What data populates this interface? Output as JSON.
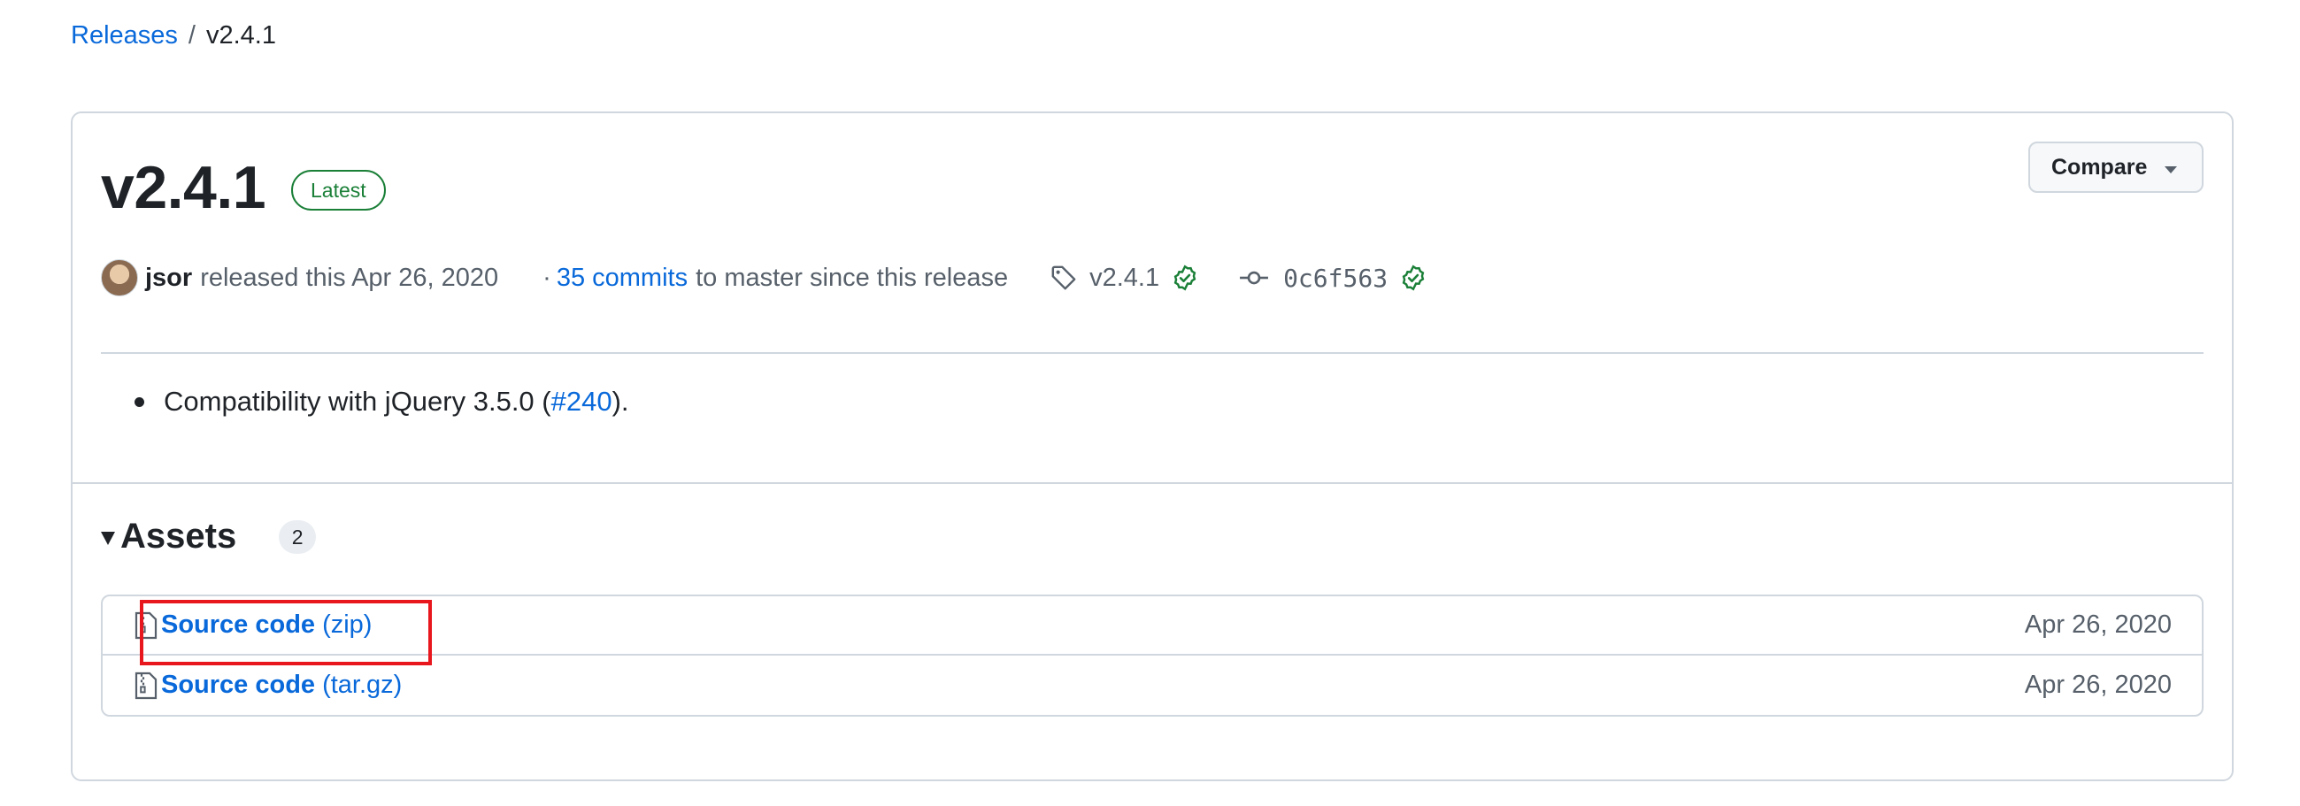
{
  "breadcrumb": {
    "parent": "Releases",
    "separator": "/",
    "current": "v2.4.1"
  },
  "release": {
    "title": "v2.4.1",
    "badge": "Latest",
    "compare_label": "Compare",
    "author": "jsor",
    "released_text": "released this Apr 26, 2020",
    "dot": "·",
    "commits_link": "35 commits",
    "commits_suffix": "to master since this release",
    "tag": "v2.4.1",
    "commit_sha": "0c6f563",
    "notes": {
      "prefix": "Compatibility with jQuery 3.5.0 (",
      "link": "#240",
      "suffix": ")."
    }
  },
  "assets": {
    "title": "Assets",
    "count": "2",
    "items": [
      {
        "name": "Source code",
        "ext": "(zip)",
        "date": "Apr 26, 2020"
      },
      {
        "name": "Source code",
        "ext": "(tar.gz)",
        "date": "Apr 26, 2020"
      }
    ]
  },
  "colors": {
    "link": "#0969da",
    "badge_green": "#1a7f37",
    "highlight": "#e8161d",
    "border": "#d0d7de"
  },
  "icons": [
    "tag-icon",
    "verified-check-icon",
    "git-commit-icon",
    "file-zip-icon",
    "triangle-down-icon",
    "caret-down-icon"
  ]
}
